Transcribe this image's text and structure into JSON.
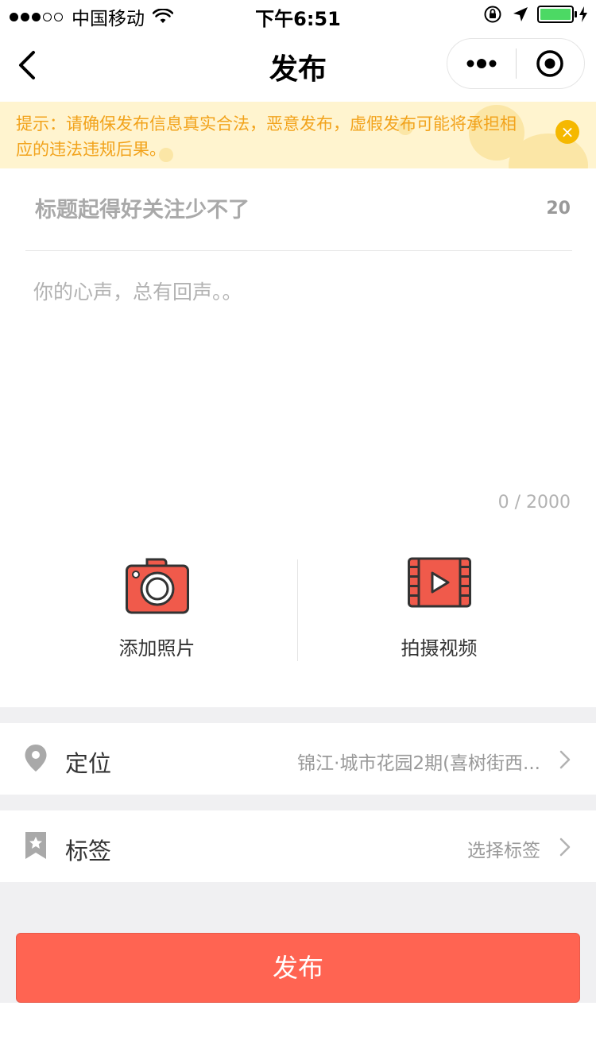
{
  "status_bar": {
    "carrier": "中国移动",
    "time": "下午6:51",
    "signal_strength": 3,
    "signal_max": 5,
    "battery_level": 1.0,
    "battery_color": "#4cd964"
  },
  "nav": {
    "title": "发布",
    "back_icon": "chevron-left-icon",
    "more_icon": "more-dots-icon",
    "close_icon": "target-icon"
  },
  "notice": {
    "text": "提示：请确保发布信息真实合法，恶意发布，虚假发布可能将承担相应的违法违规后果。",
    "close_glyph": "×",
    "color": "#f2a31c",
    "background": "#fff4cf"
  },
  "form": {
    "title_placeholder": "标题起得好关注少不了",
    "title_value": "",
    "title_counter": "20",
    "content_placeholder": "你的心声，总有回声。。",
    "content_value": "",
    "content_counter": "0 / 2000"
  },
  "media": {
    "photo_label": "添加照片",
    "video_label": "拍摄视频",
    "accent": "#f05a4b"
  },
  "location": {
    "label": "定位",
    "value": "锦江·城市花园2期(喜树街西...",
    "icon": "map-pin-icon"
  },
  "tags": {
    "label": "标签",
    "value": "选择标签",
    "icon": "bookmark-icon"
  },
  "submit": {
    "label": "发布",
    "color": "#ff6452"
  }
}
